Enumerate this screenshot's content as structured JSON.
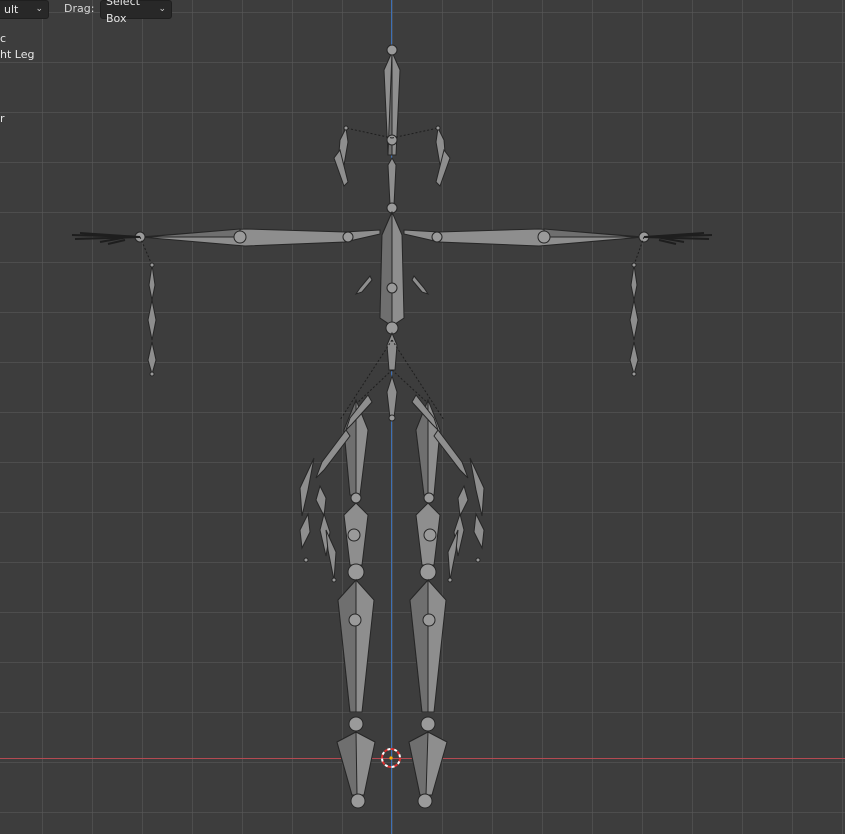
{
  "header": {
    "orientation_dropdown": {
      "value": "ult"
    },
    "drag_label": "Drag:",
    "drag_dropdown": {
      "value": "Select Box"
    }
  },
  "overlay": {
    "line1": "c",
    "line2": "ht Leg",
    "line3": "r"
  },
  "colors": {
    "background": "#3d3d3d",
    "grid": "#5a5a5a",
    "x_axis": "#b44a52",
    "z_axis": "#3c6fb5",
    "bone_fill": "#8a8a8a",
    "bone_stroke": "#2a2a2a",
    "cursor_red": "#e03030"
  },
  "icons": {
    "dropdown_chevron": "chevron-down-icon",
    "cursor": "3d-cursor-icon"
  }
}
